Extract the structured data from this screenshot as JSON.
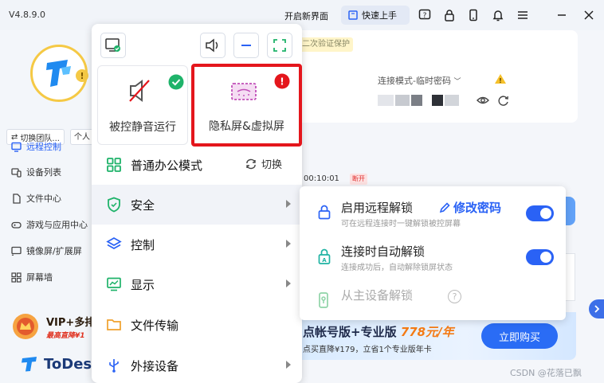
{
  "app": {
    "version": "V4.8.9.0",
    "brand_name": "ToDesk"
  },
  "topbar": {
    "open_new_ui": "开启新界面",
    "quick_start": "快速上手"
  },
  "sidebar": {
    "team_switch": "切换团队...",
    "me": "个人",
    "items": [
      {
        "label": "远程控制",
        "active": true
      },
      {
        "label": "设备列表"
      },
      {
        "label": "文件中心"
      },
      {
        "label": "游戏与应用中心"
      },
      {
        "label": "镜像屏/扩展屏"
      },
      {
        "label": "屏幕墙"
      }
    ],
    "vip": {
      "title": "VIP+多排",
      "subtitle": "最高直降¥1"
    }
  },
  "main": {
    "verify_tag": "二次验证保护",
    "conn_mode": "连接模式-临时密码",
    "session_time": "00:10:01",
    "session_tag": "断开",
    "promo": {
      "title_pre": "点帐号版+专业版 ",
      "price": "778元/年",
      "subtitle": "点买直降¥179，立省1个专业版年卡",
      "buy": "立即购买"
    }
  },
  "menu": {
    "cards": [
      {
        "label": "被控静音运行",
        "badge": "check"
      },
      {
        "label": "隐私屏&虚拟屏",
        "badge": "alert",
        "highlighted": true
      }
    ],
    "office_mode": "普通办公模式",
    "switch_label": "切换",
    "items": [
      {
        "label": "安全",
        "icon": "shield-icon",
        "has_submenu": true
      },
      {
        "label": "控制",
        "icon": "layers-icon",
        "has_submenu": true
      },
      {
        "label": "显示",
        "icon": "monitor-chart-icon",
        "has_submenu": true
      },
      {
        "label": "文件传输",
        "icon": "folder-icon",
        "has_submenu": false
      },
      {
        "label": "外接设备",
        "icon": "usb-icon",
        "has_submenu": true
      }
    ]
  },
  "submenu": {
    "remote_unlock": {
      "title": "启用远程解锁",
      "desc": "可在远程连接时一键解锁被控屏幕",
      "edit": "修改密码",
      "enabled": true
    },
    "auto_unlock": {
      "title": "连接时自动解锁",
      "desc": "连接成功后，自动解除锁屏状态",
      "enabled": true
    },
    "master_unlock": {
      "title": "从主设备解锁"
    }
  },
  "watermark": "CSDN @花落已飘",
  "colors": {
    "accent": "#2a62f5",
    "highlight": "#e4161c",
    "success": "#1fb36a"
  }
}
